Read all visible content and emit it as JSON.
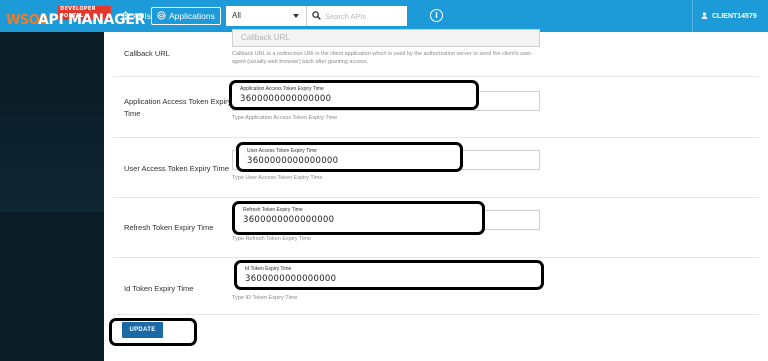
{
  "header": {
    "logo_mark": "WSO2",
    "logo_badge": "DEVELOPER PORTAL",
    "logo_name": "API MANAGER",
    "nav": {
      "apis_label": "APIs",
      "applications_label": "Applications"
    },
    "search": {
      "filter_value": "All",
      "placeholder": "Search APIs"
    },
    "user": {
      "name": "CLIENT14579"
    }
  },
  "form": {
    "callback": {
      "label": "Callback URL",
      "placeholder": "Callback URL",
      "helper": "Callback URL is a redirection URI in the client application which is used by the authorization server to send the client's user-agent (usually web browser) back after granting access."
    },
    "app_token": {
      "label_line1": "Application Access Token Expiry",
      "label_line2": "Time",
      "field_label": "Application Access Token Expiry Time",
      "value": "3600000000000000",
      "helper": "Type Application Access Token Expiry Time"
    },
    "user_token": {
      "label": "User Access Token Expiry Time",
      "field_label": "User Access Token Expiry Time",
      "value": "3600000000000000",
      "helper": "Type User Access Token Expiry Time"
    },
    "refresh_token": {
      "label": "Refresh Token Expiry Time",
      "field_label": "Refresh Token Expiry Time",
      "value": "3600000000000000",
      "helper": "Type Refresh Token Expiry Time"
    },
    "id_token": {
      "label": "Id Token Expiry Time",
      "field_label": "Id Token Expiry Time",
      "value": "3600000000000000",
      "helper": "Type ID Token Expiry Time"
    },
    "update_label": "UPDATE"
  },
  "icons": {
    "apis": "gear-icon",
    "applications": "applications-icon",
    "search": "search-icon",
    "help": "info-icon",
    "user": "user-icon",
    "dropdown": "caret-down-icon"
  },
  "colors": {
    "header": "#1d9bd9",
    "sidebar": "#0b1d27",
    "button": "#1a6aa8",
    "highlight": "#000000"
  }
}
